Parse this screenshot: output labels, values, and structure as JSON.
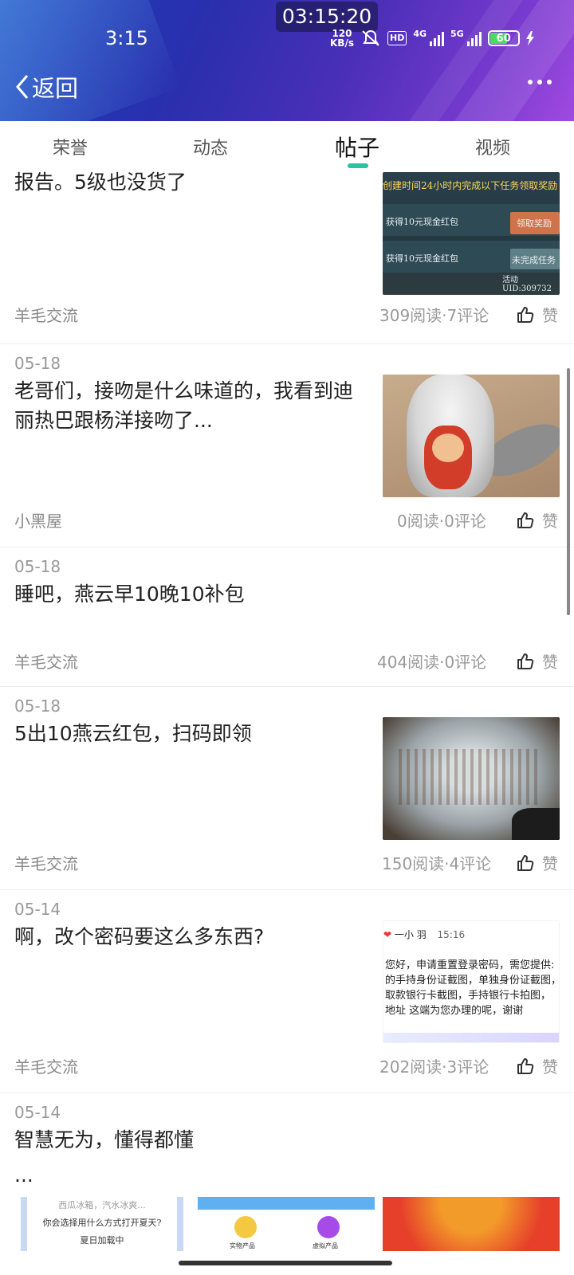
{
  "status_bar": {
    "clock_overlay": "03:15:20",
    "time": "3:15",
    "speed_value": "120",
    "speed_unit": "KB/s",
    "hd_label": "HD",
    "net_1": "4G",
    "net_2": "5G",
    "battery": "60"
  },
  "header": {
    "back_label": "返回"
  },
  "tabs": [
    "荣誉",
    "动态",
    "帖子",
    "视频"
  ],
  "active_tab_index": 2,
  "posts": [
    {
      "date": "",
      "title": "报告。5级也没货了",
      "category": "羊毛交流",
      "stats": "309阅读·7评论",
      "like_label": "赞",
      "thumb": {
        "line1": "创建时间24小时内完成以下任务领取奖励",
        "line2": "获得10元现金红包",
        "btn1": "领取奖励",
        "line3": "获得10元现金红包",
        "btn2": "未完成任务",
        "line4": "活动UID:309732"
      }
    },
    {
      "date": "05-18",
      "title": "老哥们，接吻是什么味道的，我看到迪丽热巴跟杨洋接吻了...",
      "category": "小黑屋",
      "stats": "0阅读·0评论",
      "like_label": "赞"
    },
    {
      "date": "05-18",
      "title": "睡吧，燕云早10晚10补包",
      "category": "羊毛交流",
      "stats": "404阅读·0评论",
      "like_label": "赞"
    },
    {
      "date": "05-18",
      "title": "5出10燕云红包，扫码即领",
      "category": "羊毛交流",
      "stats": "150阅读·4评论",
      "like_label": "赞"
    },
    {
      "date": "05-14",
      "title": "啊，改个密码要这么多东西?",
      "category": "羊毛交流",
      "stats": "202阅读·3评论",
      "like_label": "赞",
      "thumb": {
        "user": "一小 羽",
        "time": "15:16",
        "msg1": "您好，申请重置登录密码，需您提供:",
        "msg2": "的手持身份证截图，单独身份证截图，",
        "msg3": "取款银行卡截图，手持银行卡拍图，",
        "msg4": "地址 这端为您办理的呢，谢谢"
      }
    },
    {
      "date": "05-14",
      "title": "智慧无为，懂得都懂",
      "excerpt": "..."
    }
  ],
  "bottom_previews": {
    "card1_line1": "西瓜冰箱，汽水冰爽...",
    "card1_line2": "你会选择用什么方式打开夏天?",
    "card1_line3": "夏日加载中",
    "card2_label1": "实物产品",
    "card2_label2": "虚拟产品"
  },
  "colors": {
    "tab_indicator": "#2bc4a3",
    "header_start": "#1b3fb8",
    "header_end": "#a04ae0"
  }
}
